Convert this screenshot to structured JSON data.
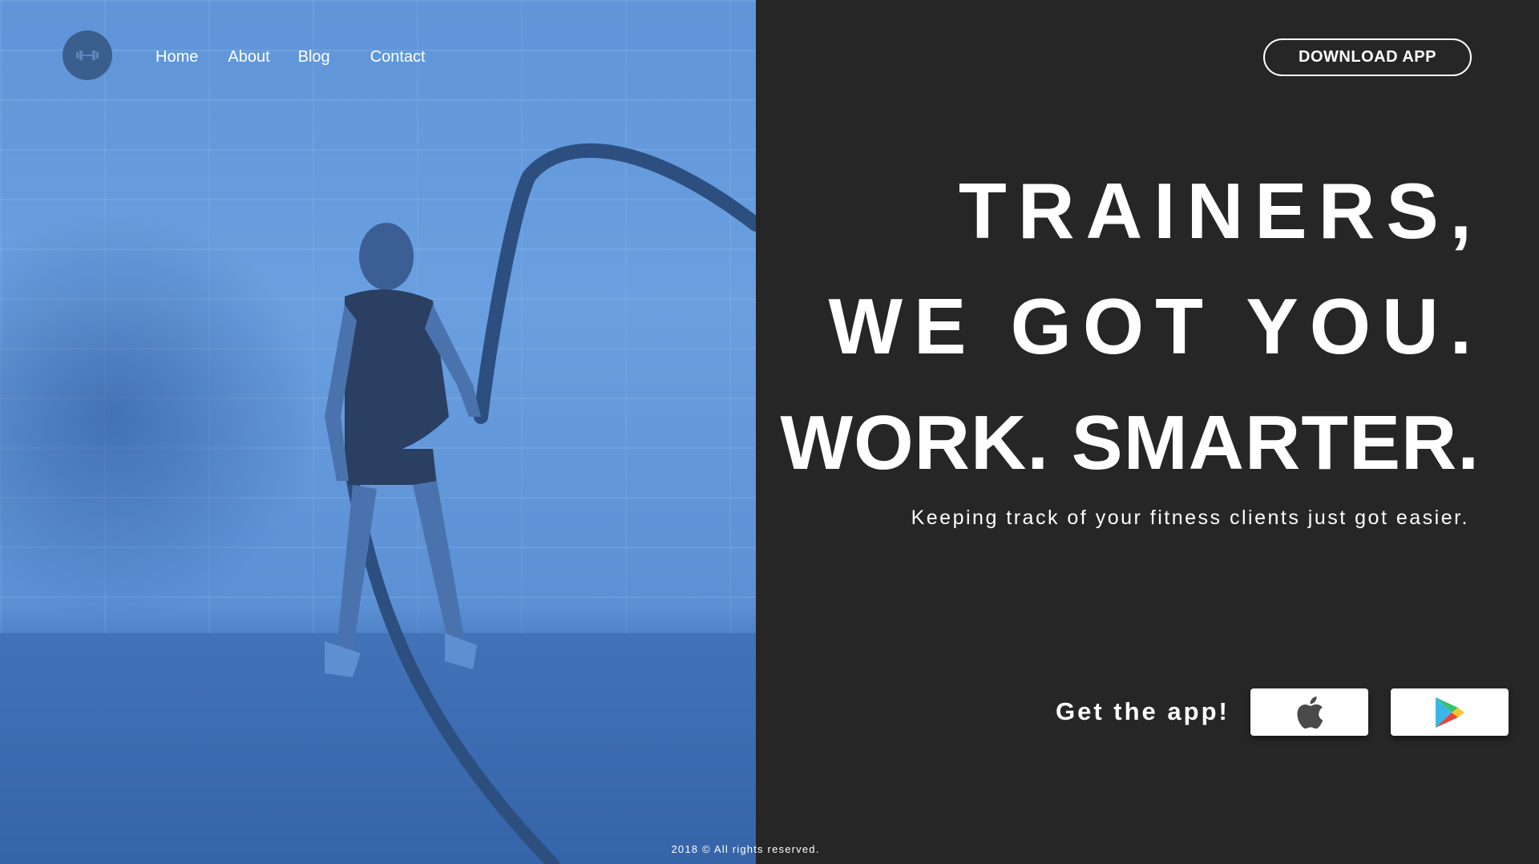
{
  "nav": {
    "logo_icon": "dumbbell-icon",
    "items": [
      "Home",
      "About",
      "Blog",
      "Contact"
    ]
  },
  "header": {
    "download_label": "DOWNLOAD APP"
  },
  "hero": {
    "line1": "TRAINERS,",
    "line2": "WE GOT YOU.",
    "line3": "WORK. SMARTER.",
    "subheadline": "Keeping track of your fitness clients just got easier."
  },
  "app_section": {
    "label": "Get the app!",
    "apple_icon": "apple-icon",
    "google_icon": "google-play-icon"
  },
  "footer": {
    "text": "2018 © All rights reserved."
  },
  "colors": {
    "background": "#262626",
    "hero_overlay": "#5f95d8",
    "logo": "#3a5f8f",
    "text": "#ffffff"
  }
}
